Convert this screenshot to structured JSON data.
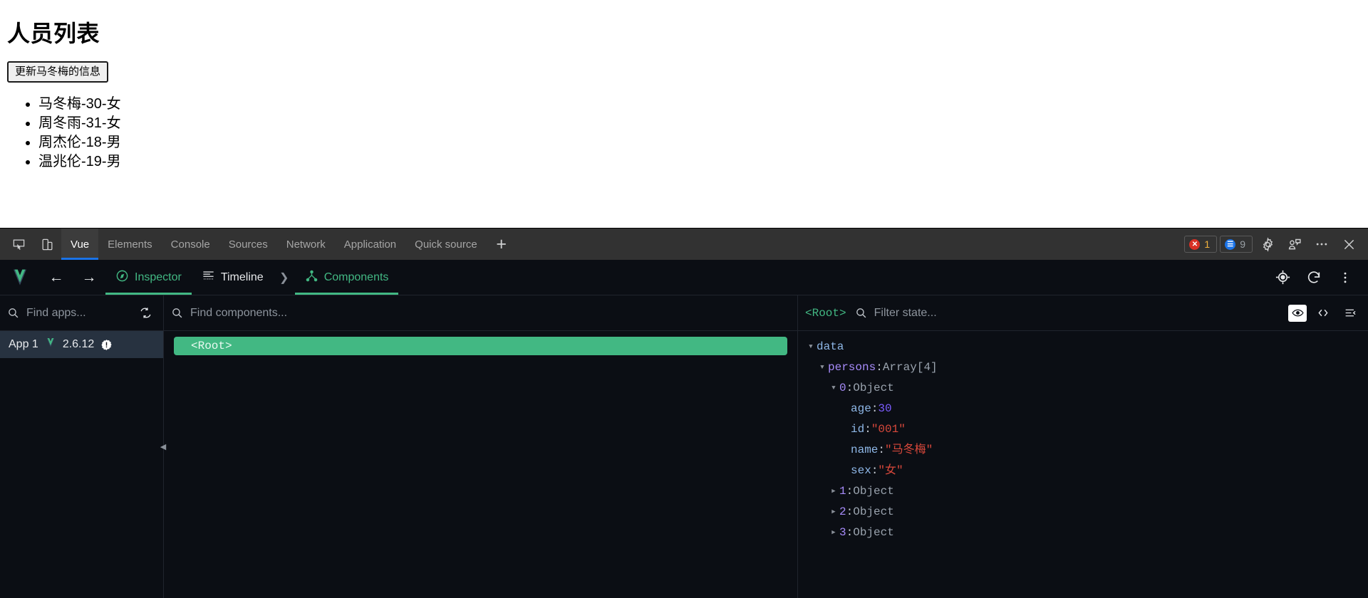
{
  "page": {
    "title": "人员列表",
    "update_button": "更新马冬梅的信息",
    "persons": [
      "马冬梅-30-女",
      "周冬雨-31-女",
      "周杰伦-18-男",
      "温兆伦-19-男"
    ]
  },
  "devtools": {
    "tabs": [
      {
        "label": "Vue",
        "active": true
      },
      {
        "label": "Elements",
        "active": false
      },
      {
        "label": "Console",
        "active": false
      },
      {
        "label": "Sources",
        "active": false
      },
      {
        "label": "Network",
        "active": false
      },
      {
        "label": "Application",
        "active": false
      },
      {
        "label": "Quick source",
        "active": false
      }
    ],
    "add_tab_label": "+",
    "error_count": "1",
    "message_count": "9",
    "icons": {
      "inspect": "inspect-element-icon",
      "device": "device-toolbar-icon",
      "settings": "gear-icon",
      "vue_devtools": "vue-devtools-icon",
      "more": "more-options-icon",
      "close": "close-icon"
    },
    "accent_blue": "#1a73e8",
    "error_red": "#d93025"
  },
  "vue_nav": {
    "logo": "vue-logo",
    "back": "←",
    "forward": "→",
    "tabs": [
      {
        "label": "Inspector",
        "selected": true
      },
      {
        "label": "Timeline",
        "selected": false
      }
    ],
    "chevron": "❯",
    "components_tab": "Components",
    "right_icons": {
      "target": "target-icon",
      "refresh": "refresh-icon",
      "more": "more-vertical-icon"
    },
    "accent_green": "#42b883"
  },
  "apps_pane": {
    "search_placeholder": "Find apps...",
    "search_value": "",
    "refresh_icon": "refresh-apps-icon",
    "apps": [
      {
        "name": "App 1",
        "version": "2.6.12",
        "warning": true
      }
    ]
  },
  "components_pane": {
    "search_placeholder": "Find components...",
    "search_value": "",
    "tree": [
      {
        "label": "<Root>",
        "selected": true
      }
    ],
    "collapse_handle": "◀"
  },
  "state_pane": {
    "breadcrumb": "<Root>",
    "filter_placeholder": "Filter state...",
    "filter_value": "",
    "header_icons": {
      "eye": "eye-box-icon",
      "code": "open-in-editor-icon",
      "collapse": "collapse-all-icon"
    },
    "tree": [
      {
        "indent": 0,
        "caret": "open",
        "key": "data",
        "keyClass": "k-key",
        "sep": "",
        "value": "",
        "valueClass": ""
      },
      {
        "indent": 1,
        "caret": "open",
        "key": "persons",
        "keyClass": "k-prop",
        "sep": ": ",
        "value": "Array[4]",
        "valueClass": "k-type"
      },
      {
        "indent": 2,
        "caret": "open",
        "key": "0",
        "keyClass": "k-idx",
        "sep": ": ",
        "value": "Object",
        "valueClass": "k-type"
      },
      {
        "indent": 3,
        "caret": "none",
        "key": "age",
        "keyClass": "k-key",
        "sep": ": ",
        "value": "30",
        "valueClass": "k-num"
      },
      {
        "indent": 3,
        "caret": "none",
        "key": "id",
        "keyClass": "k-key",
        "sep": ": ",
        "value": "\"001\"",
        "valueClass": "k-str"
      },
      {
        "indent": 3,
        "caret": "none",
        "key": "name",
        "keyClass": "k-key",
        "sep": ": ",
        "value": "\"马冬梅\"",
        "valueClass": "k-str"
      },
      {
        "indent": 3,
        "caret": "none",
        "key": "sex",
        "keyClass": "k-key",
        "sep": ": ",
        "value": "\"女\"",
        "valueClass": "k-str"
      },
      {
        "indent": 2,
        "caret": "closed",
        "key": "1",
        "keyClass": "k-idx",
        "sep": ": ",
        "value": "Object",
        "valueClass": "k-type"
      },
      {
        "indent": 2,
        "caret": "closed",
        "key": "2",
        "keyClass": "k-idx",
        "sep": ": ",
        "value": "Object",
        "valueClass": "k-type"
      },
      {
        "indent": 2,
        "caret": "closed",
        "key": "3",
        "keyClass": "k-idx",
        "sep": ": ",
        "value": "Object",
        "valueClass": "k-type"
      }
    ]
  }
}
